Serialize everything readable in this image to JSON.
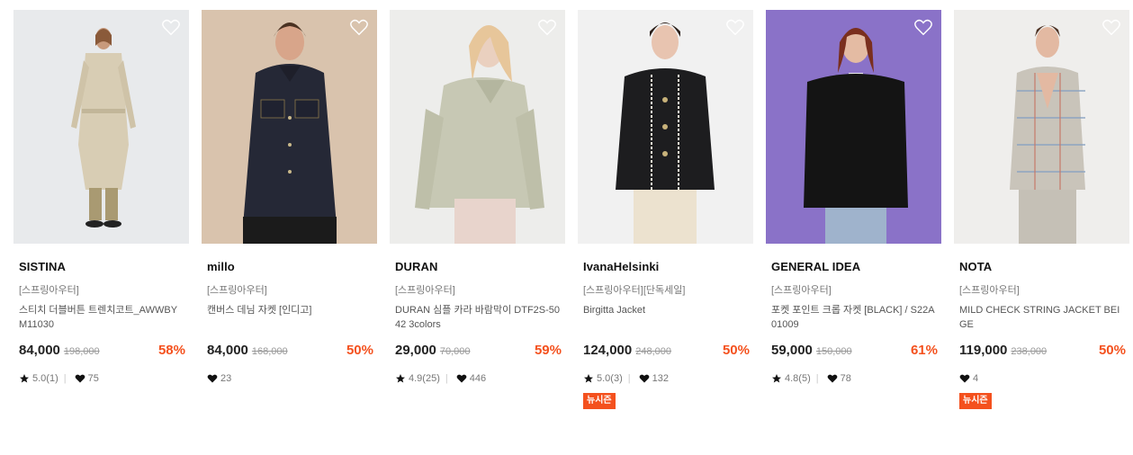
{
  "products": [
    {
      "brand": "SISTINA",
      "category": "[스프링아우터]",
      "name": "스티치 더블버튼 트렌치코트_AWWBYM11030",
      "price": "84,000",
      "original_price": "198,000",
      "discount": "58%",
      "rating": "5.0(1)",
      "likes": "75",
      "badge": "",
      "image_desc": "trench-coat-model"
    },
    {
      "brand": "millo",
      "category": "[스프링아우터]",
      "name": "캔버스 데님 자켓 [인디고]",
      "price": "84,000",
      "original_price": "168,000",
      "discount": "50%",
      "rating": "",
      "likes": "23",
      "badge": "",
      "image_desc": "denim-jacket-model"
    },
    {
      "brand": "DURAN",
      "category": "[스프링아우터]",
      "name": "DURAN 심플 카라 바람막이 DTF2S-5042 3colors",
      "price": "29,000",
      "original_price": "70,000",
      "discount": "59%",
      "rating": "4.9(25)",
      "likes": "446",
      "badge": "",
      "image_desc": "windbreaker-model"
    },
    {
      "brand": "IvanaHelsinki",
      "category": "[스프링아우터][단독세일]",
      "name": "Birgitta Jacket",
      "price": "124,000",
      "original_price": "248,000",
      "discount": "50%",
      "rating": "5.0(3)",
      "likes": "132",
      "badge": "뉴시즌",
      "image_desc": "tweed-jacket-model"
    },
    {
      "brand": "GENERAL IDEA",
      "category": "[스프링아우터]",
      "name": "포켓 포인트 크롭 자켓 [BLACK] / S22A01009",
      "price": "59,000",
      "original_price": "150,000",
      "discount": "61%",
      "rating": "4.8(5)",
      "likes": "78",
      "badge": "",
      "image_desc": "black-blazer-model"
    },
    {
      "brand": "NOTA",
      "category": "[스프링아우터]",
      "name": "MILD CHECK STRING JACKET BEIGE",
      "price": "119,000",
      "original_price": "238,000",
      "discount": "50%",
      "rating": "",
      "likes": "4",
      "badge": "뉴시즌",
      "image_desc": "check-jacket-model"
    }
  ],
  "colors": {
    "accent": "#f4511e",
    "text": "#222222",
    "muted": "#777777"
  }
}
